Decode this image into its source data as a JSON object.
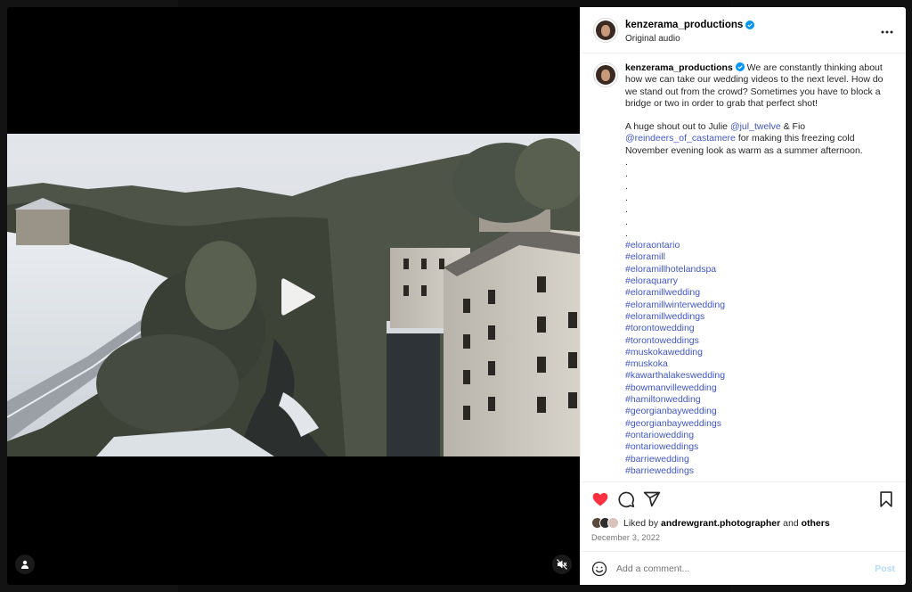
{
  "post": {
    "author": "kenzerama_productions",
    "audio": "Original audio",
    "caption_intro": "We are constantly thinking about how we can take our wedding videos to the next level. How do we stand out from the crowd? Sometimes you have to block a bridge or two in order to grab that perfect shot!",
    "shoutout_prefix": "A huge shout out to Julie",
    "mention_1": "@jul_twelve",
    "shoutout_mid": "& Fio",
    "mention_2": "@reindeers_of_castamere",
    "shoutout_suffix": "for making this freezing cold November evening look as warm as a summer afternoon.",
    "dots": [
      ".",
      ".",
      ".",
      ".",
      ".",
      ".",
      "."
    ],
    "hashtags": [
      "#eloraontario",
      "#eloramill",
      "#eloramillhotelandspa",
      "#eloraquarry",
      "#eloramillwedding",
      "#eloramillwinterwedding",
      "#eloramillweddings",
      "#torontowedding",
      "#torontoweddings",
      "#muskokawedding",
      "#muskoka",
      "#kawarthalakeswedding",
      "#bowmanvillewedding",
      "#hamiltonwedding",
      "#georgianbaywedding",
      "#georgianbayweddings",
      "#ontariowedding",
      "#ontarioweddings",
      "#barriewedding",
      "#barrieweddings"
    ],
    "liked_by_prefix": "Liked by",
    "liked_by_user": "andrewgrant.photographer",
    "liked_by_and": "and",
    "liked_by_others": "others",
    "date": "December 3, 2022"
  },
  "comment": {
    "placeholder": "Add a comment...",
    "post_label": "Post"
  },
  "icons": {
    "like": "heart-icon",
    "comment": "comment-icon",
    "share": "paper-plane-icon",
    "save": "bookmark-icon",
    "emoji": "emoji-icon",
    "play": "play-icon",
    "mute": "speaker-muted-icon",
    "tag": "user-tag-icon",
    "more": "more-dots-icon",
    "verified": "verified-badge-icon"
  },
  "colors": {
    "like_red": "#ff3040",
    "link_blue": "#4056c8",
    "verified_blue": "#0095f6",
    "post_disabled": "#b3dbff"
  }
}
